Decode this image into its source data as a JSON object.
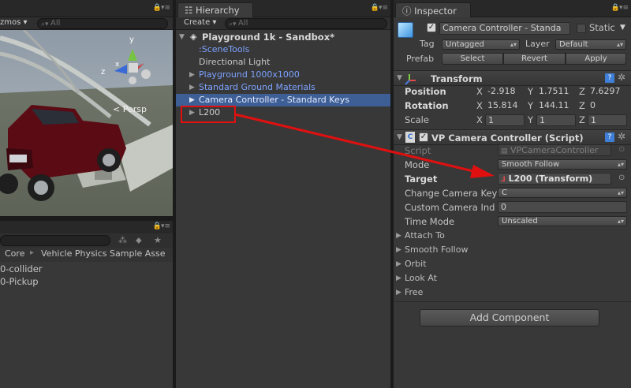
{
  "scene": {
    "gizmos_label": "zmos",
    "search_placeholder": "All",
    "view_axis_y": "y",
    "view_axis_z": "z",
    "view_axis_x": "x",
    "persp_label": "Persp"
  },
  "project": {
    "breadcrumb": [
      "Core",
      "Vehicle Physics Sample Asse"
    ],
    "items": [
      "0-collider",
      "0-Pickup"
    ]
  },
  "hierarchy": {
    "tab": "Hierarchy",
    "create_label": "Create",
    "search_placeholder": "All",
    "scene_name": "Playground 1k - Sandbox*",
    "items": [
      {
        "label": ":SceneTools",
        "prefab": true,
        "arrow": false
      },
      {
        "label": "Directional Light",
        "prefab": false,
        "arrow": false
      },
      {
        "label": "Playground 1000x1000",
        "prefab": true,
        "arrow": true
      },
      {
        "label": "Standard Ground Materials",
        "prefab": true,
        "arrow": true
      },
      {
        "label": "Camera Controller - Standard Keys",
        "prefab": true,
        "arrow": true,
        "selected": true
      },
      {
        "label": "L200",
        "prefab": false,
        "arrow": true,
        "highlighted": true
      }
    ]
  },
  "inspector": {
    "tab": "Inspector",
    "object_name": "Camera Controller - Standa",
    "static_label": "Static",
    "tag_label": "Tag",
    "tag_value": "Untagged",
    "layer_label": "Layer",
    "layer_value": "Default",
    "prefab_label": "Prefab",
    "prefab_buttons": [
      "Select",
      "Revert",
      "Apply"
    ],
    "transform": {
      "title": "Transform",
      "position_label": "Position",
      "rotation_label": "Rotation",
      "scale_label": "Scale",
      "position": {
        "x": "-2.918",
        "y": "1.7511",
        "z": "7.6297"
      },
      "rotation": {
        "x": "15.814",
        "y": "144.11",
        "z": "0"
      },
      "scale": {
        "x": "1",
        "y": "1",
        "z": "1"
      }
    },
    "script": {
      "title": "VP Camera Controller (Script)",
      "fields": [
        {
          "label": "Script",
          "value": "VPCameraController",
          "kind": "object",
          "dim": true
        },
        {
          "label": "Mode",
          "value": "Smooth Follow",
          "kind": "popup"
        },
        {
          "label": "Target",
          "value": "L200 (Transform)",
          "kind": "object",
          "bold": true
        },
        {
          "label": "Change Camera Key",
          "value": "C",
          "kind": "popup"
        },
        {
          "label": "Custom Camera Ind",
          "value": "0",
          "kind": "field"
        },
        {
          "label": "Time Mode",
          "value": "Unscaled",
          "kind": "popup"
        }
      ],
      "foldouts": [
        "Attach To",
        "Smooth Follow",
        "Orbit",
        "Look At",
        "Free"
      ]
    },
    "add_component": "Add Component"
  },
  "colors": {
    "annotation_red": "#e01010",
    "selection_blue": "#3e5f96",
    "prefab_blue": "#7ca2ff"
  }
}
